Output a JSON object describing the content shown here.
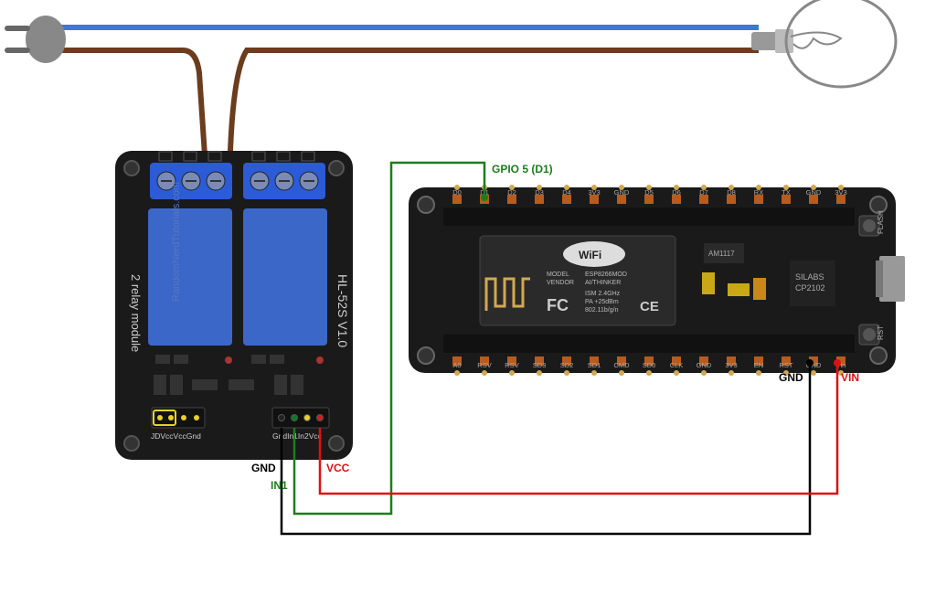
{
  "relay_module": {
    "title": "HL-52S V1.0",
    "subtitle": "2 relay module",
    "watermark": "RandomNerdTutorials.com",
    "jumper_labels": "JDVccVccGnd",
    "pin_labels": "GndIn1In2Vcc"
  },
  "nodemcu": {
    "wifi_label": "WiFi",
    "model_label": "MODEL",
    "vendor_label": "VENDOR",
    "chip_model": "ESP8266MOD",
    "chip_vendor": "AI/THINKER",
    "ism": "ISM 2.4GHz",
    "power": "PA +25dBm",
    "ieee": "802.11b/g/n",
    "regulator": "AM1117",
    "usb_chip_top": "SILABS",
    "usb_chip_bottom": "CP2102",
    "flash_button": "FLASH",
    "rst_button": "RST",
    "top_pins": [
      "D0",
      "D1",
      "D2",
      "D3",
      "D4",
      "3V3",
      "GND",
      "D5",
      "D6",
      "D7",
      "D8",
      "RX",
      "TX",
      "GND",
      "3V3"
    ],
    "bottom_pins": [
      "A0",
      "RSV",
      "RSV",
      "SD3",
      "SD2",
      "SD1",
      "CMD",
      "SD0",
      "CLK",
      "GND",
      "3V3",
      "EN",
      "RST",
      "GND",
      "Vin"
    ]
  },
  "wires": {
    "gpio": "GPIO 5 (D1)",
    "gnd_relay": "GND",
    "vcc_relay": "VCC",
    "in1": "IN1",
    "gnd_mcu": "GND",
    "vin_mcu": "VIN"
  }
}
